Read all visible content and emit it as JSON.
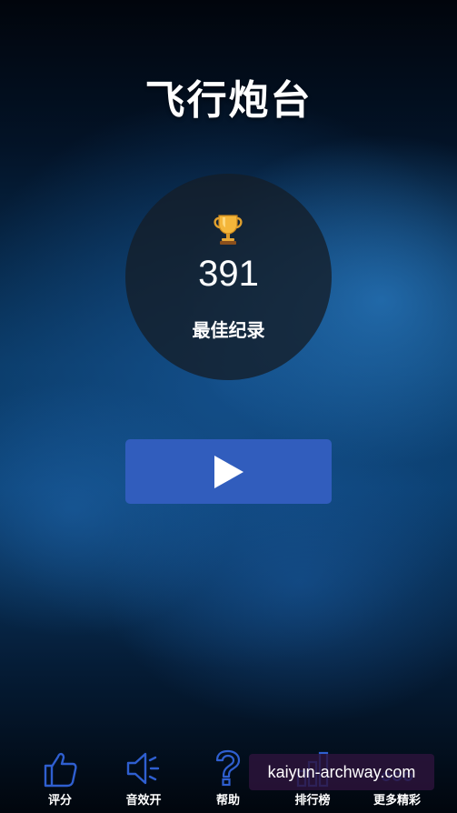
{
  "app": {
    "title": "飞行炮台"
  },
  "score": {
    "icon": "trophy-icon",
    "value": "391",
    "label": "最佳纪录"
  },
  "play_button": {
    "icon": "play-icon"
  },
  "bottom_nav": [
    {
      "label": "评分",
      "icon": "thumbs-up-icon"
    },
    {
      "label": "音效开",
      "icon": "speaker-icon"
    },
    {
      "label": "帮助",
      "icon": "question-icon"
    },
    {
      "label": "排行榜",
      "icon": "bar-chart-icon"
    },
    {
      "label": "更多精彩",
      "icon": "more-icon"
    }
  ],
  "watermark": {
    "text": "kaiyun-archway.com"
  },
  "colors": {
    "accent": "#315dbd",
    "icon_stroke": "#2f5fd0",
    "circle_bg": "#141e28"
  }
}
